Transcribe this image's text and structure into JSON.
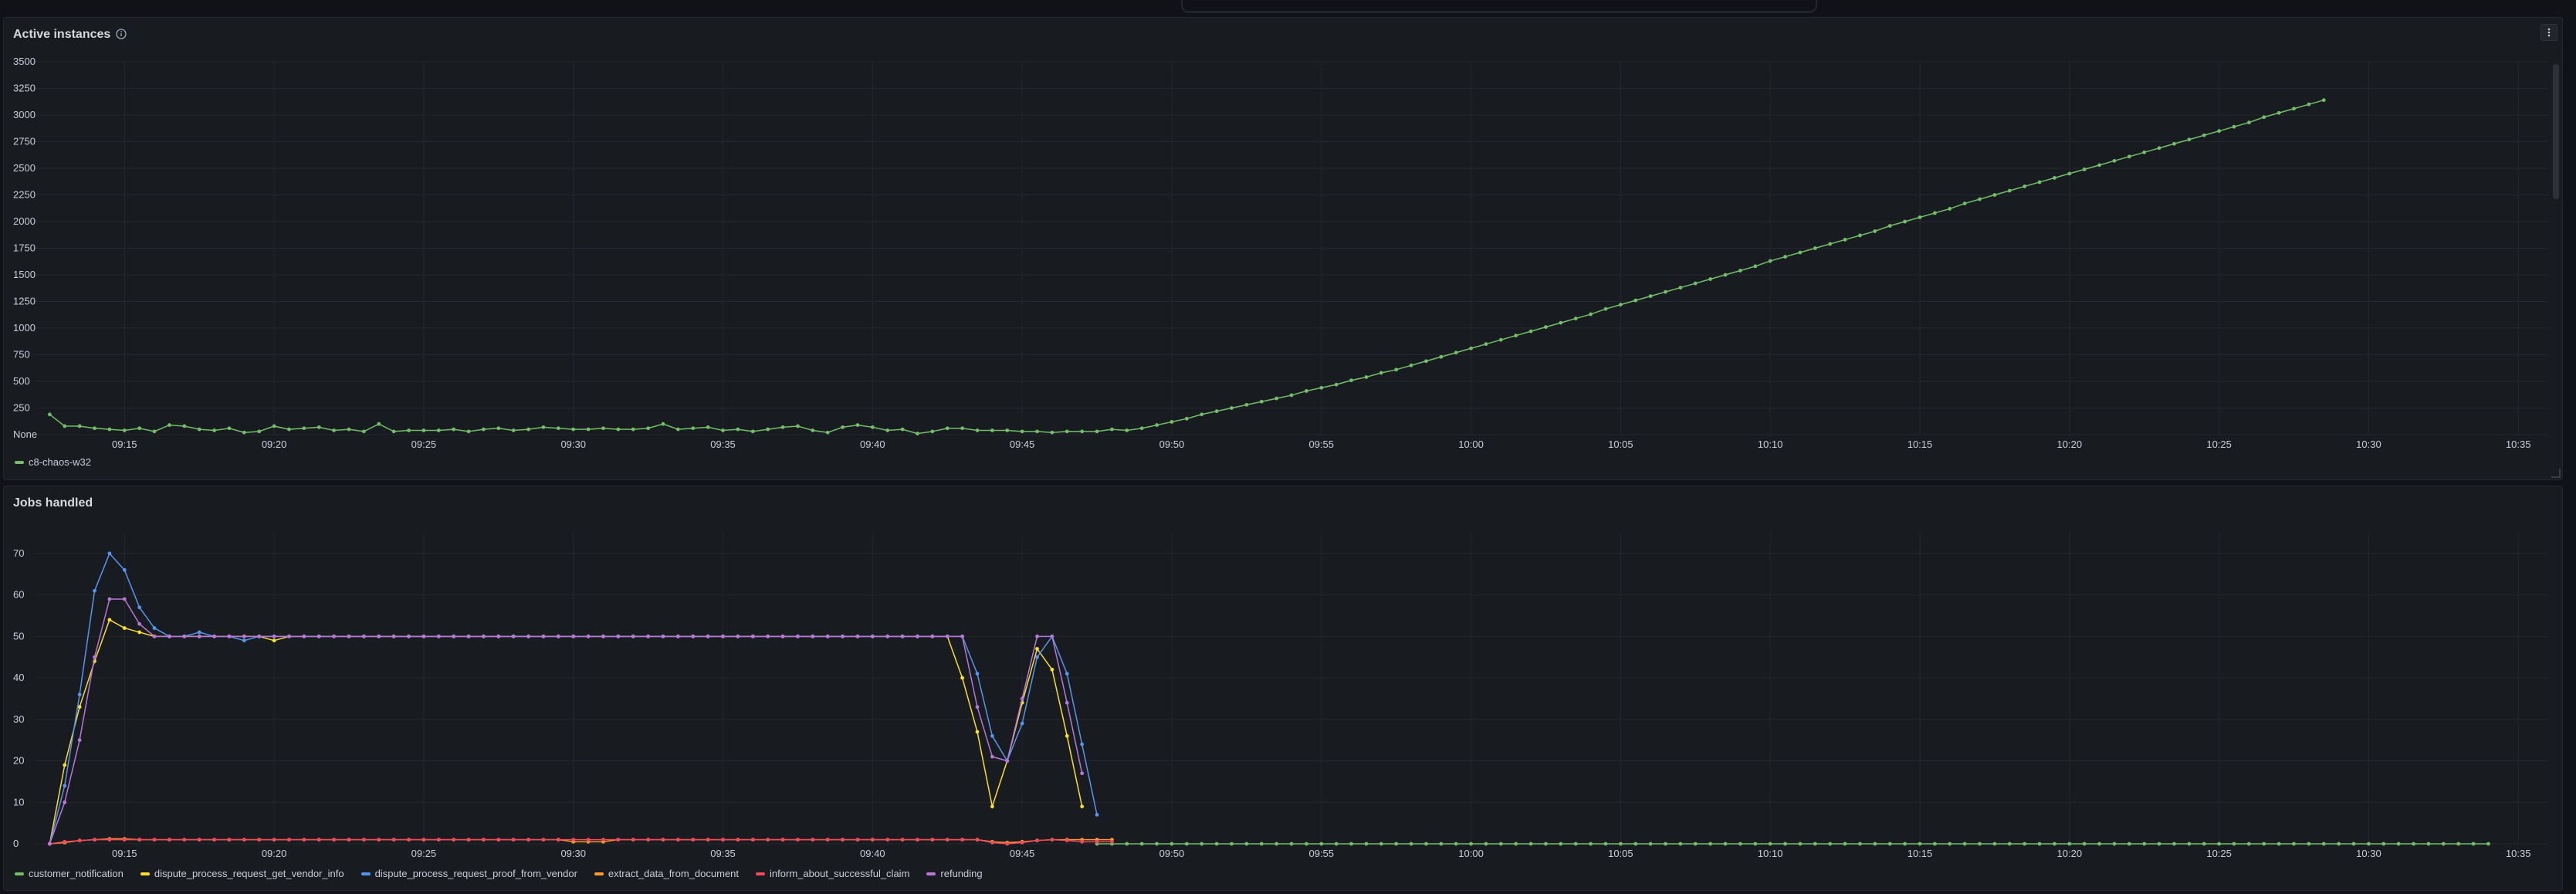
{
  "panels": [
    {
      "title": "Active instances",
      "chart_data": {
        "type": "line",
        "x_ticks": [
          "09:15",
          "09:20",
          "09:25",
          "09:30",
          "09:35",
          "09:40",
          "09:45",
          "09:50",
          "09:55",
          "10:00",
          "10:05",
          "10:10",
          "10:15",
          "10:20",
          "10:25",
          "10:30",
          "10:35"
        ],
        "y_ticks": [
          "None",
          "250",
          "500",
          "750",
          "1000",
          "1250",
          "1500",
          "1750",
          "2000",
          "2250",
          "2500",
          "2750",
          "3000",
          "3250",
          "3500"
        ],
        "ylim": [
          0,
          3500
        ],
        "x_range": [
          "09:12",
          "10:36"
        ],
        "series": [
          {
            "name": "c8-chaos-w32",
            "color": "#73bf69",
            "x_start": "09:12:30",
            "x_step_seconds": 30,
            "values": [
              190,
              80,
              80,
              60,
              50,
              40,
              60,
              30,
              90,
              80,
              50,
              40,
              60,
              20,
              30,
              80,
              50,
              60,
              70,
              40,
              50,
              30,
              100,
              30,
              40,
              40,
              40,
              50,
              30,
              50,
              60,
              40,
              50,
              70,
              60,
              50,
              50,
              60,
              50,
              50,
              60,
              100,
              50,
              60,
              70,
              40,
              50,
              30,
              50,
              70,
              80,
              40,
              20,
              70,
              90,
              70,
              40,
              50,
              10,
              30,
              60,
              60,
              40,
              40,
              40,
              30,
              30,
              20,
              30,
              30,
              30,
              50,
              40,
              60,
              90,
              120,
              150,
              190,
              220,
              250,
              280,
              310,
              340,
              370,
              410,
              440,
              470,
              510,
              540,
              580,
              610,
              650,
              690,
              730,
              770,
              810,
              850,
              890,
              930,
              970,
              1010,
              1050,
              1090,
              1130,
              1180,
              1220,
              1260,
              1300,
              1340,
              1380,
              1420,
              1460,
              1500,
              1540,
              1580,
              1630,
              1670,
              1710,
              1750,
              1790,
              1830,
              1870,
              1910,
              1960,
              2000,
              2040,
              2080,
              2120,
              2170,
              2210,
              2250,
              2290,
              2330,
              2370,
              2410,
              2450,
              2490,
              2530,
              2570,
              2610,
              2650,
              2690,
              2730,
              2770,
              2810,
              2850,
              2890,
              2930,
              2980,
              3020,
              3060,
              3100,
              3140
            ]
          }
        ],
        "legend": [
          "c8-chaos-w32"
        ],
        "grid": true,
        "legend_placement": "bottom-left"
      }
    },
    {
      "title": "Jobs handled",
      "chart_data": {
        "type": "line",
        "x_ticks": [
          "09:15",
          "09:20",
          "09:25",
          "09:30",
          "09:35",
          "09:40",
          "09:45",
          "09:50",
          "09:55",
          "10:00",
          "10:05",
          "10:10",
          "10:15",
          "10:20",
          "10:25",
          "10:30",
          "10:35"
        ],
        "y_ticks": [
          "0",
          "10",
          "20",
          "30",
          "40",
          "50",
          "60",
          "70"
        ],
        "ylim": [
          0,
          75
        ],
        "x_range": [
          "09:12",
          "10:36"
        ],
        "x_start": "09:12:30",
        "x_step_seconds": 30,
        "series": [
          {
            "name": "customer_notification",
            "color": "#73bf69",
            "values_note": "0 from 09:46 onward",
            "start_index": 70,
            "values": [
              0,
              0,
              0,
              0,
              0,
              0,
              0,
              0,
              0,
              0,
              0,
              0,
              0,
              0,
              0,
              0,
              0,
              0,
              0,
              0,
              0,
              0,
              0,
              0,
              0,
              0,
              0,
              0,
              0,
              0,
              0,
              0,
              0,
              0,
              0,
              0,
              0,
              0,
              0,
              0,
              0,
              0,
              0,
              0,
              0,
              0,
              0,
              0,
              0,
              0,
              0,
              0,
              0,
              0,
              0,
              0,
              0,
              0,
              0,
              0,
              0,
              0,
              0,
              0,
              0,
              0,
              0,
              0,
              0,
              0,
              0,
              0,
              0,
              0,
              0,
              0,
              0,
              0,
              0,
              0,
              0,
              0,
              0,
              0,
              0,
              0,
              0,
              0,
              0,
              0,
              0,
              0,
              0,
              0
            ]
          },
          {
            "name": "dispute_process_request_get_vendor_info",
            "color": "#fade2a",
            "start_index": 0,
            "values": [
              0,
              19,
              33,
              44,
              54,
              52,
              51,
              50,
              50,
              50,
              50,
              50,
              50,
              50,
              50,
              49,
              50,
              50,
              50,
              50,
              50,
              50,
              50,
              50,
              50,
              50,
              50,
              50,
              50,
              50,
              50,
              50,
              50,
              50,
              50,
              50,
              50,
              50,
              50,
              50,
              50,
              50,
              50,
              50,
              50,
              50,
              50,
              50,
              50,
              50,
              50,
              50,
              50,
              50,
              50,
              50,
              50,
              50,
              50,
              50,
              50,
              40,
              27,
              9,
              20,
              34,
              47,
              42,
              26,
              9
            ]
          },
          {
            "name": "dispute_process_request_proof_from_vendor",
            "color": "#5794f2",
            "start_index": 0,
            "values": [
              0,
              14,
              36,
              61,
              70,
              66,
              57,
              52,
              50,
              50,
              51,
              50,
              50,
              49,
              50,
              50,
              50,
              50,
              50,
              50,
              50,
              50,
              50,
              50,
              50,
              50,
              50,
              50,
              50,
              50,
              50,
              50,
              50,
              50,
              50,
              50,
              50,
              50,
              50,
              50,
              50,
              50,
              50,
              50,
              50,
              50,
              50,
              50,
              50,
              50,
              50,
              50,
              50,
              50,
              50,
              50,
              50,
              50,
              50,
              50,
              50,
              50,
              41,
              26,
              20,
              29,
              45,
              50,
              41,
              24,
              7
            ]
          },
          {
            "name": "extract_data_from_document",
            "color": "#ff9830",
            "start_index": 0,
            "values": [
              0,
              0.3,
              0.8,
              1,
              1.2,
              1.2,
              1,
              1,
              1,
              1,
              1,
              1,
              1,
              1,
              1,
              1,
              1,
              1,
              1,
              1,
              1,
              1,
              1,
              1,
              1,
              1,
              1,
              1,
              1,
              1,
              1,
              1,
              1,
              1,
              1,
              0.5,
              0.5,
              0.5,
              1,
              1,
              1,
              1,
              1,
              1,
              1,
              1,
              1,
              1,
              1,
              1,
              1,
              1,
              1,
              1,
              1,
              1,
              1,
              1,
              1,
              1,
              1,
              1,
              1,
              0.5,
              0.3,
              0.5,
              0.8,
              1,
              1,
              1,
              1,
              1
            ]
          },
          {
            "name": "inform_about_successful_claim",
            "color": "#f2495c",
            "start_index": 0,
            "values": [
              0,
              0.5,
              0.8,
              1,
              1,
              1,
              1,
              1,
              1,
              1,
              1,
              1,
              1,
              1,
              1,
              1,
              1,
              1,
              1,
              1,
              1,
              1,
              1,
              1,
              1,
              1,
              1,
              1,
              1,
              1,
              1,
              1,
              1,
              1,
              1,
              1,
              1,
              1,
              1,
              1,
              1,
              1,
              1,
              1,
              1,
              1,
              1,
              1,
              1,
              1,
              1,
              1,
              1,
              1,
              1,
              1,
              1,
              1,
              1,
              1,
              1,
              1,
              1,
              0.3,
              0,
              0.3,
              0.8,
              1,
              0.8,
              0.5,
              0.5,
              0.5
            ]
          },
          {
            "name": "refunding",
            "color": "#b877d9",
            "start_index": 0,
            "values": [
              0,
              10,
              25,
              45,
              59,
              59,
              53,
              50,
              50,
              50,
              50,
              50,
              50,
              50,
              50,
              50,
              50,
              50,
              50,
              50,
              50,
              50,
              50,
              50,
              50,
              50,
              50,
              50,
              50,
              50,
              50,
              50,
              50,
              50,
              50,
              50,
              50,
              50,
              50,
              50,
              50,
              50,
              50,
              50,
              50,
              50,
              50,
              50,
              50,
              50,
              50,
              50,
              50,
              50,
              50,
              50,
              50,
              50,
              50,
              50,
              50,
              50,
              33,
              21,
              20,
              35,
              50,
              50,
              34,
              17
            ]
          }
        ],
        "legend": [
          "customer_notification",
          "dispute_process_request_get_vendor_info",
          "dispute_process_request_proof_from_vendor",
          "extract_data_from_document",
          "inform_about_successful_claim",
          "refunding"
        ],
        "grid": true,
        "legend_placement": "bottom-left"
      }
    }
  ]
}
